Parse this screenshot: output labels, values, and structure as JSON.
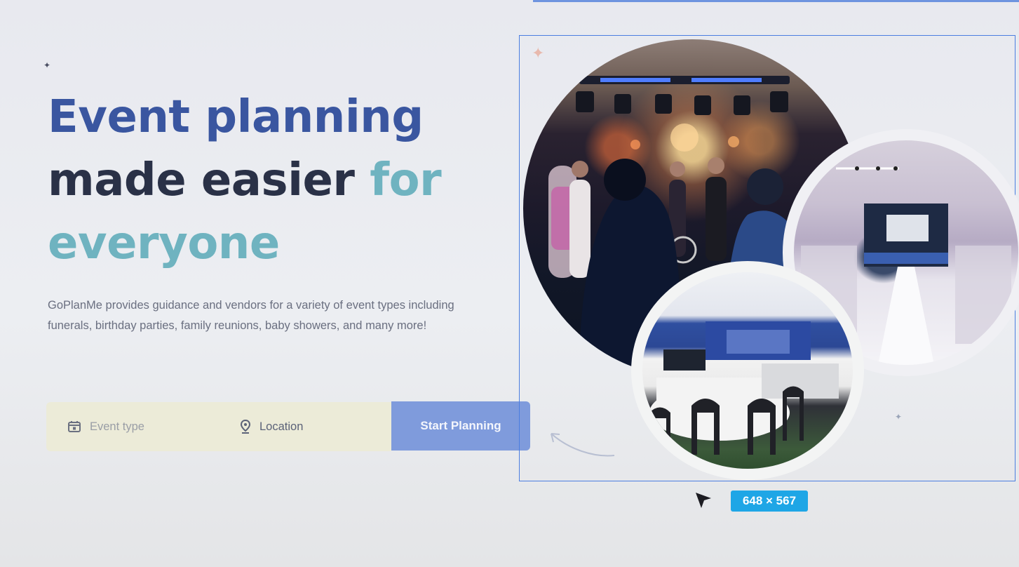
{
  "hero": {
    "headline_line1_a": "Event",
    "headline_line1_b": "planning",
    "headline_line2_a": "made easier",
    "headline_line2_b": "for",
    "headline_line3": "everyone",
    "description": "GoPlanMe provides guidance and vendors for a variety of event types including funerals, birthday parties, family reunions, baby showers, and many more!"
  },
  "search": {
    "event_type_placeholder": "Event type",
    "location_label": "Location",
    "start_button": "Start Planning",
    "event_icon": "calendar-icon",
    "location_icon": "location-pin-icon"
  },
  "images": [
    {
      "name": "concert-stage-photo"
    },
    {
      "name": "wedding-venue-photo"
    },
    {
      "name": "banquet-hall-photo"
    }
  ],
  "selection": {
    "dimensions_label": "648 × 567"
  },
  "colors": {
    "headline_blue": "#3a56a0",
    "headline_dark": "#2a3147",
    "headline_teal": "#6fb3c0",
    "button": "#7f9bdc",
    "selection_border": "#4b7ee0",
    "badge": "#1ea6e6"
  }
}
